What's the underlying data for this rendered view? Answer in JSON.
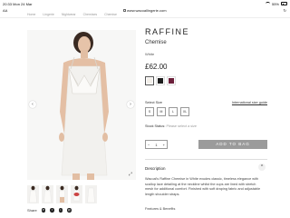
{
  "status_bar": {
    "time": "20:33",
    "date": "Mon 24 Mar",
    "battery": "55%"
  },
  "browser": {
    "text_size_label": "AA",
    "url": "www.wacoallingerie.com",
    "reload_glyph": "↻"
  },
  "breadcrumb": [
    "Home",
    "Lingerie",
    "Nightwear",
    "Chemises",
    "Chemise"
  ],
  "gallery": {
    "prev_glyph": "‹",
    "next_glyph": "›",
    "zoom_glyph": "⤢",
    "thumbnail_count": 5
  },
  "share": {
    "label": "Share",
    "icons": [
      "pinterest-icon",
      "facebook-icon",
      "twitter-icon",
      "email-icon"
    ]
  },
  "product": {
    "title": "RAFFINE",
    "subtitle": "Chemise",
    "colour": "White",
    "price": "£62.00",
    "swatches": [
      {
        "name": "ivory",
        "color": "#f3efe9"
      },
      {
        "name": "black",
        "color": "#1c1c1c"
      },
      {
        "name": "berry",
        "color": "#6b1f3a"
      }
    ],
    "select_size_label": "Select Size",
    "size_guide_label": "International size guide",
    "sizes": [
      "S",
      "M",
      "L",
      "XL"
    ],
    "stock_label": "Stock Status:",
    "stock_hint": "Please select a size",
    "quantity": "1",
    "qty_minus": "−",
    "qty_plus": "+",
    "add_to_bag": "ADD TO BAG",
    "description_heading": "Description",
    "description_toggle": "^",
    "description_text": "Wacoal's Raffine Chemise in White exudes classic, timeless elegance with scallop lace detailing at the neckline whilst the cups are lined with stretch mesh for additional comfort. Finished with soft draping fabric and adjustable length shoulder straps.",
    "features_heading": "Features & Benefits"
  },
  "colors": {
    "button_disabled": "#9b9b9b",
    "text_primary": "#222222",
    "text_muted": "#999999"
  }
}
